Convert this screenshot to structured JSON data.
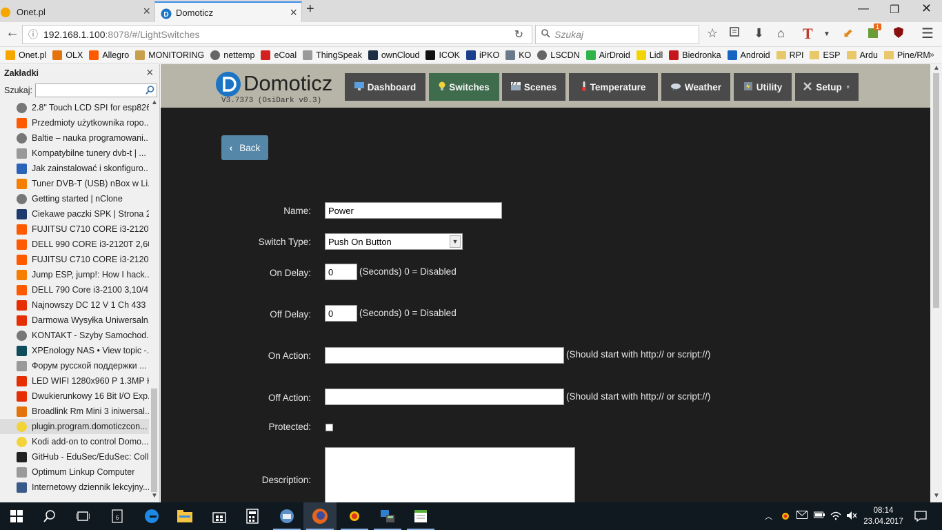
{
  "browser": {
    "tabs": [
      {
        "title": "Onet.pl",
        "active": false
      },
      {
        "title": "Domoticz",
        "active": true
      }
    ],
    "url_host": "192.168.1.100",
    "url_path": ":8078/#/LightSwitches",
    "search_placeholder": "Szukaj",
    "addon_badge": "1",
    "bookmarks": [
      {
        "label": "Onet.pl",
        "icon": "onet-icon",
        "color": "#f7a600"
      },
      {
        "label": "OLX",
        "icon": "olx-icon",
        "color": "#e5730c"
      },
      {
        "label": "Allegro",
        "icon": "allegro-icon",
        "color": "#ff5a00"
      },
      {
        "label": "MONITORING",
        "icon": "monitoring-icon",
        "color": "#c9a04a"
      },
      {
        "label": "nettemp",
        "icon": "globe-icon",
        "color": "#666666"
      },
      {
        "label": "eCoal",
        "icon": "ecoal-icon",
        "color": "#d32020"
      },
      {
        "label": "ThingSpeak",
        "icon": "page-icon",
        "color": "#9a9a9a"
      },
      {
        "label": "ownCloud",
        "icon": "owncloud-icon",
        "color": "#1d2d44"
      },
      {
        "label": "ICOK",
        "icon": "icok-icon",
        "color": "#111111"
      },
      {
        "label": "iPKO",
        "icon": "pko-icon",
        "color": "#1a3e8c"
      },
      {
        "label": "KO",
        "icon": "ko-icon",
        "color": "#6a7a8a"
      },
      {
        "label": "LSCDN",
        "icon": "globe-icon",
        "color": "#666666"
      },
      {
        "label": "AirDroid",
        "icon": "airdroid-icon",
        "color": "#2fb34a"
      },
      {
        "label": "Lidl",
        "icon": "lidl-icon",
        "color": "#f2d400"
      },
      {
        "label": "Biedronka",
        "icon": "biedronka-icon",
        "color": "#c4161c"
      },
      {
        "label": "Android",
        "icon": "android-m-icon",
        "color": "#1565c0"
      },
      {
        "label": "RPI",
        "icon": "folder-icon",
        "color": "#e8c86a"
      },
      {
        "label": "ESP",
        "icon": "folder-icon",
        "color": "#e8c86a"
      },
      {
        "label": "Ardu",
        "icon": "folder-icon",
        "color": "#e8c86a"
      },
      {
        "label": "Pine/RM",
        "icon": "folder-icon",
        "color": "#e8c86a"
      }
    ]
  },
  "sidebar": {
    "title": "Zakładki",
    "search_label": "Szukaj:",
    "items": [
      {
        "label": "2.8\" Touch LCD SPI for esp826...",
        "icon": "globe-icon",
        "color": "#777777"
      },
      {
        "label": "Przedmioty użytkownika ropo...",
        "icon": "allegro-icon",
        "color": "#ff5a00"
      },
      {
        "label": "Baltie – nauka programowani...",
        "icon": "globe-icon",
        "color": "#777777"
      },
      {
        "label": "Kompatybilne tunery dvb-t | ...",
        "icon": "synology-icon",
        "color": "#999999"
      },
      {
        "label": "Jak zainstalować i skonfiguro...",
        "icon": "webblog-icon",
        "color": "#2a63b8"
      },
      {
        "label": "Tuner DVB-T (USB) nBox w Li...",
        "icon": "blogger-icon",
        "color": "#f57d00"
      },
      {
        "label": "Getting started | nClone",
        "icon": "globe-icon",
        "color": "#777777"
      },
      {
        "label": "Ciekawe paczki SPK | Strona 2 ...",
        "icon": "pronas-icon",
        "color": "#1f3b6e"
      },
      {
        "label": "FUJITSU C710 CORE i3-2120T ...",
        "icon": "allegro-icon",
        "color": "#ff5a00"
      },
      {
        "label": "DELL 990 CORE i3-2120T 2,60/...",
        "icon": "allegro-icon",
        "color": "#ff5a00"
      },
      {
        "label": "FUJITSU C710 CORE i3-2120 3,...",
        "icon": "allegro-icon",
        "color": "#ff5a00"
      },
      {
        "label": "Jump ESP, jump!: How I hack...",
        "icon": "blogger-icon",
        "color": "#f57d00"
      },
      {
        "label": "DELL 790 Core i3-2100 3,10/4....",
        "icon": "allegro-icon",
        "color": "#ff5a00"
      },
      {
        "label": "Najnowszy DC 12 V 1 Ch 433 ...",
        "icon": "aliexpress-icon",
        "color": "#e62e04"
      },
      {
        "label": "Darmowa Wysyłka Uniwersaln...",
        "icon": "aliexpress-icon",
        "color": "#e62e04"
      },
      {
        "label": "KONTAKT - Szyby Samochod...",
        "icon": "globe-icon",
        "color": "#777777"
      },
      {
        "label": "XPEnology NAS • View topic -...",
        "icon": "xpenology-icon",
        "color": "#0f4c5c"
      },
      {
        "label": "Форум русской поддержки ...",
        "icon": "synology-icon",
        "color": "#999999"
      },
      {
        "label": "LED WIFI 1280x960 P 1.3MP Ka...",
        "icon": "aliexpress-icon",
        "color": "#e62e04"
      },
      {
        "label": "Dwukierunkowy 16 Bit I/O Exp...",
        "icon": "aliexpress-icon",
        "color": "#e62e04"
      },
      {
        "label": "Broadlink Rm Mini 3 iniwersal...",
        "icon": "olx-icon",
        "color": "#e5730c"
      },
      {
        "label": "plugin.program.domoticzcon...",
        "icon": "lightbulb-icon",
        "color": "#f2d33a"
      },
      {
        "label": "Kodi add-on to control Domo...",
        "icon": "lightbulb-icon",
        "color": "#f2d33a"
      },
      {
        "label": "GitHub - EduSec/EduSec: Coll...",
        "icon": "github-icon",
        "color": "#222222"
      },
      {
        "label": "Optimum Linkup Computer",
        "icon": "page-icon",
        "color": "#9a9a9a"
      },
      {
        "label": "Internetowy dziennik lekcyjny...",
        "icon": "laptop-icon",
        "color": "#3a5a8a"
      }
    ],
    "selected_index": 21
  },
  "domoticz": {
    "logo": "Domoticz",
    "version": "V3.7373 (OsiDark v0.3)",
    "nav": [
      {
        "label": "Dashboard",
        "icon": "monitor-icon",
        "active": false
      },
      {
        "label": "Switches",
        "icon": "lightbulb-icon",
        "active": true
      },
      {
        "label": "Scenes",
        "icon": "clapper-icon",
        "active": false
      },
      {
        "label": "Temperature",
        "icon": "thermometer-icon",
        "active": false
      },
      {
        "label": "Weather",
        "icon": "cloud-icon",
        "active": false
      },
      {
        "label": "Utility",
        "icon": "utility-icon",
        "active": false
      },
      {
        "label": "Setup",
        "icon": "wrench-icon",
        "active": false
      }
    ],
    "back_label": "Back",
    "form": {
      "name_label": "Name:",
      "name_value": "Power",
      "switch_type_label": "Switch Type:",
      "switch_type_value": "Push On Button",
      "on_delay_label": "On Delay:",
      "on_delay_value": "0",
      "on_delay_hint": "(Seconds) 0 = Disabled",
      "off_delay_label": "Off Delay:",
      "off_delay_value": "0",
      "off_delay_hint": "(Seconds) 0 = Disabled",
      "on_action_label": "On Action:",
      "on_action_value": "",
      "on_action_hint": "(Should start with http:// or script://)",
      "off_action_label": "Off Action:",
      "off_action_value": "",
      "off_action_hint": "(Should start with http:// or script://)",
      "protected_label": "Protected:",
      "protected_checked": false,
      "description_label": "Description:",
      "description_value": ""
    }
  },
  "taskbar": {
    "time": "08:14",
    "date": "23.04.2017"
  }
}
